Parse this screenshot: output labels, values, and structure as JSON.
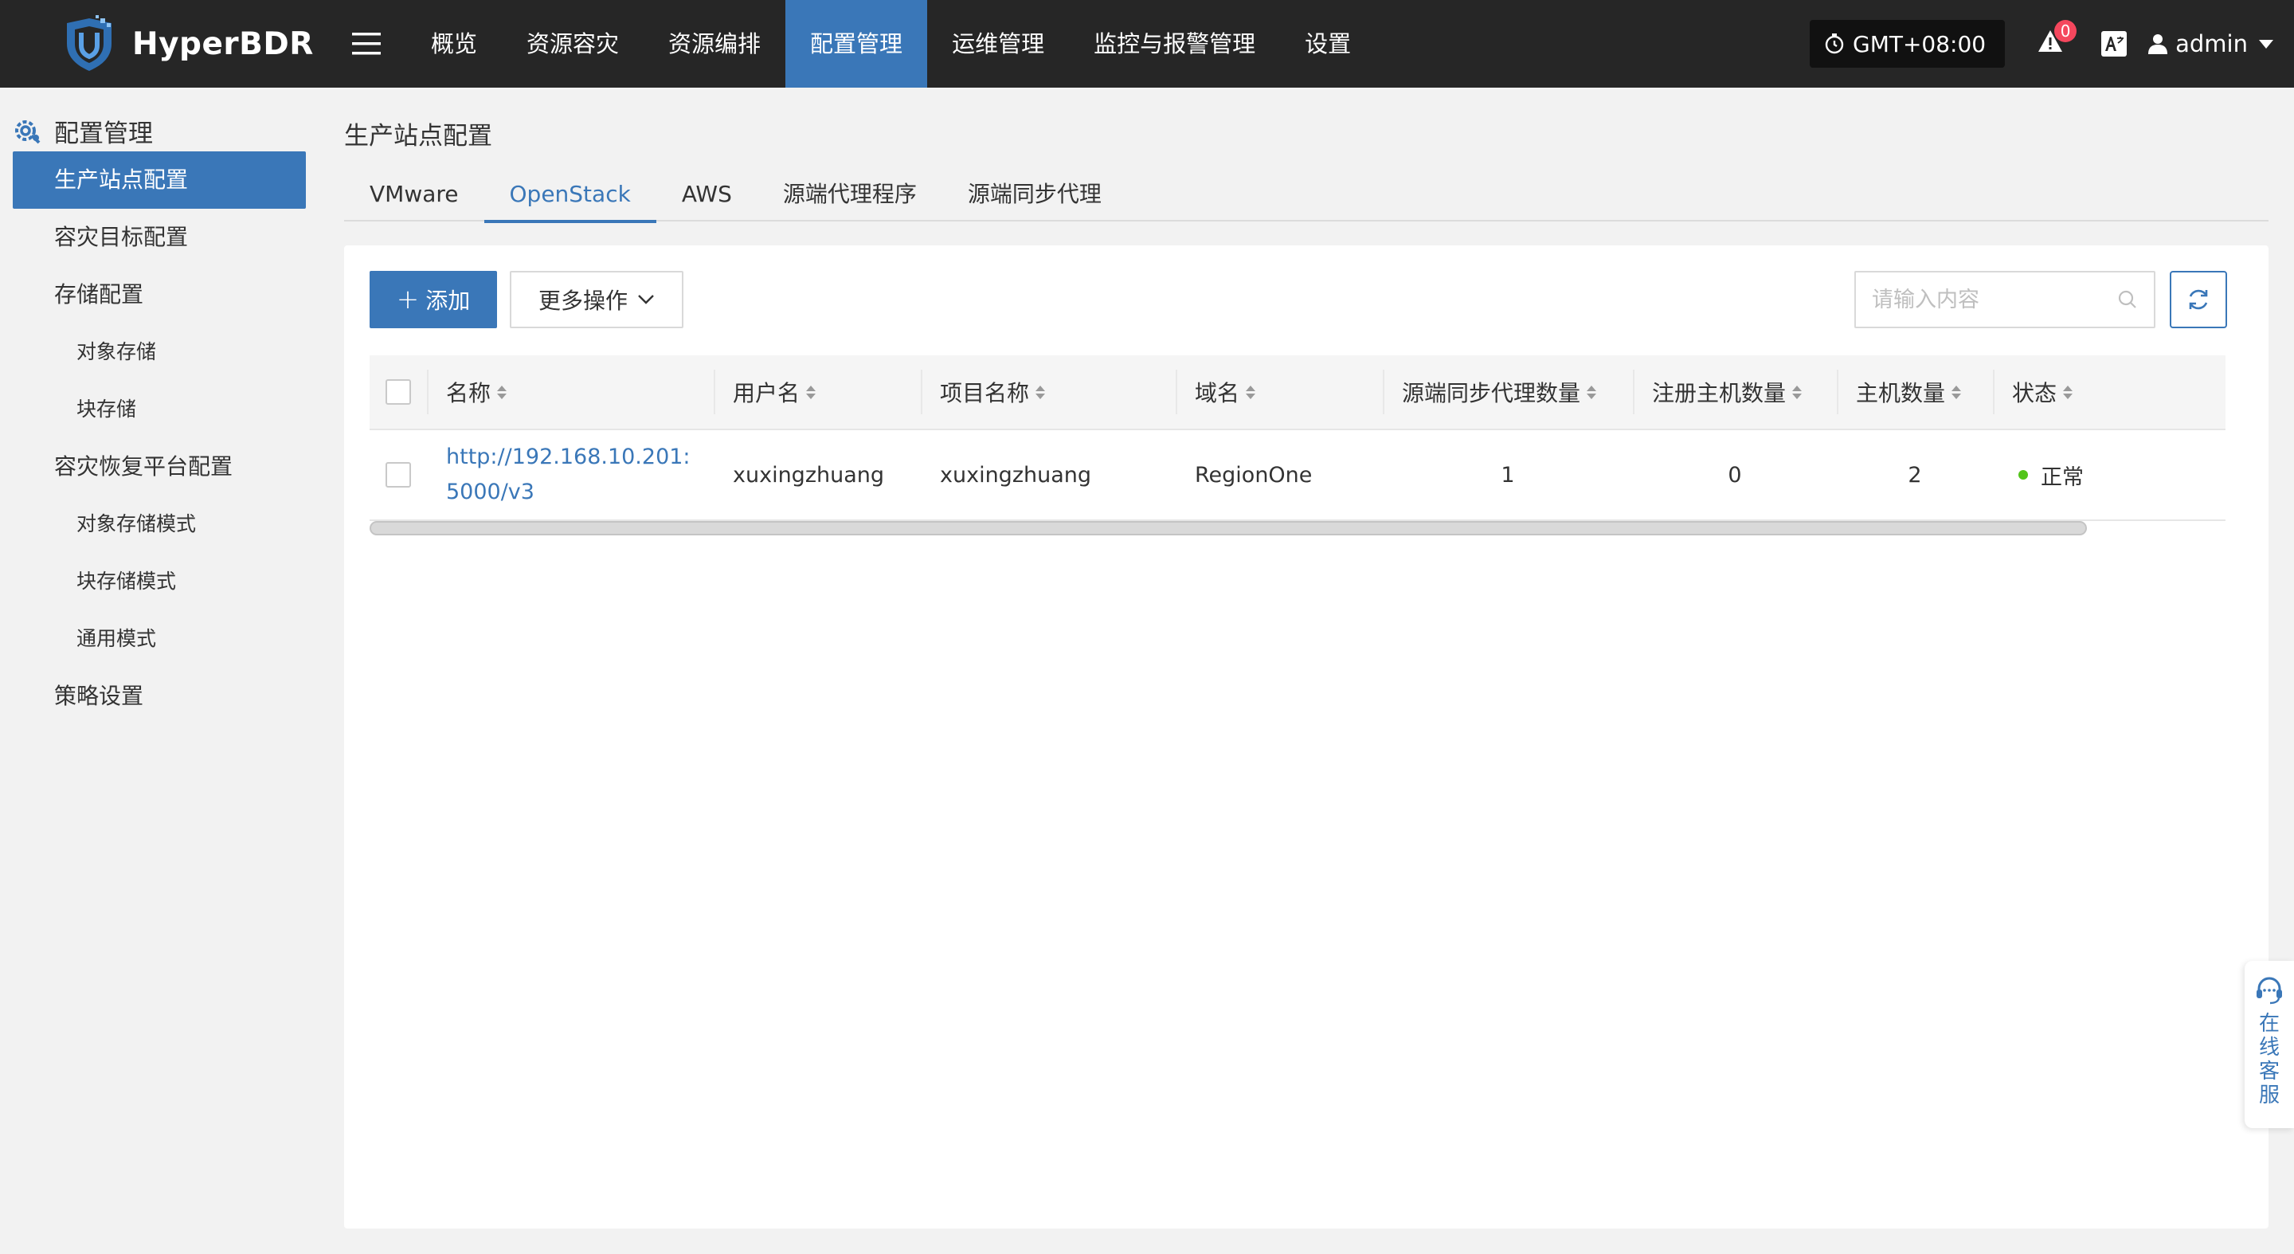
{
  "header": {
    "brand": "HyperBDR",
    "nav": [
      {
        "label": "概览",
        "active": false
      },
      {
        "label": "资源容灾",
        "active": false
      },
      {
        "label": "资源编排",
        "active": false
      },
      {
        "label": "配置管理",
        "active": true
      },
      {
        "label": "运维管理",
        "active": false
      },
      {
        "label": "监控与报警管理",
        "active": false
      },
      {
        "label": "设置",
        "active": false
      }
    ],
    "timezone": "GMT+08:00",
    "alert_count": "0",
    "user": "admin"
  },
  "sidebar": {
    "title": "配置管理",
    "items": [
      {
        "label": "生产站点配置",
        "level": 1,
        "active": true
      },
      {
        "label": "容灾目标配置",
        "level": 1,
        "active": false
      },
      {
        "label": "存储配置",
        "level": 1,
        "active": false
      },
      {
        "label": "对象存储",
        "level": 2,
        "active": false
      },
      {
        "label": "块存储",
        "level": 2,
        "active": false
      },
      {
        "label": "容灾恢复平台配置",
        "level": 1,
        "active": false
      },
      {
        "label": "对象存储模式",
        "level": 2,
        "active": false
      },
      {
        "label": "块存储模式",
        "level": 2,
        "active": false
      },
      {
        "label": "通用模式",
        "level": 2,
        "active": false
      },
      {
        "label": "策略设置",
        "level": 1,
        "active": false
      }
    ]
  },
  "main": {
    "title": "生产站点配置",
    "tabs": [
      {
        "label": "VMware",
        "active": false
      },
      {
        "label": "OpenStack",
        "active": true
      },
      {
        "label": "AWS",
        "active": false
      },
      {
        "label": "源端代理程序",
        "active": false
      },
      {
        "label": "源端同步代理",
        "active": false
      }
    ],
    "toolbar": {
      "add_label": "添加",
      "more_label": "更多操作",
      "search_placeholder": "请输入内容"
    },
    "table": {
      "columns": [
        "名称",
        "用户名",
        "项目名称",
        "域名",
        "源端同步代理数量",
        "注册主机数量",
        "主机数量",
        "状态"
      ],
      "rows": [
        {
          "name": "http://192.168.10.201:5000/v3",
          "username": "xuxingzhuang",
          "project": "xuxingzhuang",
          "domain": "RegionOne",
          "sync_agents": "1",
          "registered_hosts": "0",
          "hosts": "2",
          "status": "正常"
        }
      ]
    }
  },
  "support": {
    "label": "在线客服"
  },
  "colors": {
    "accent": "#3a77b8",
    "topbar": "#262626",
    "status_ok": "#52c41a",
    "badge": "#f5475d"
  }
}
